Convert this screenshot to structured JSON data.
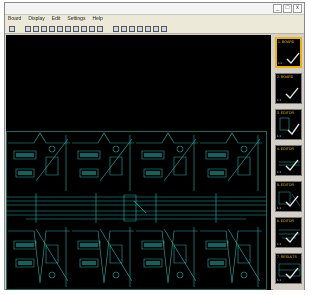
{
  "menu": [
    "Board",
    "Display",
    "Edit",
    "Settings",
    "Help"
  ],
  "window_controls": [
    "_",
    "□",
    "x"
  ],
  "thumbnails": [
    {
      "title": "1. BOARD",
      "footer": "1:1"
    },
    {
      "title": "2. BOARD",
      "footer": "1:1"
    },
    {
      "title": "3. EDITOR",
      "footer": "1:1"
    },
    {
      "title": "4. EDITOR",
      "footer": "1:1"
    },
    {
      "title": "5. EDITOR",
      "footer": "1:1"
    },
    {
      "title": "6. EDITOR",
      "footer": "1:1"
    },
    {
      "title": "7. RESULTS",
      "footer": "1:1"
    }
  ],
  "colors": {
    "trace": "#1fb0a8",
    "accent": "#f0b400",
    "canvas": "#000000",
    "check": "#e6e6e6"
  }
}
